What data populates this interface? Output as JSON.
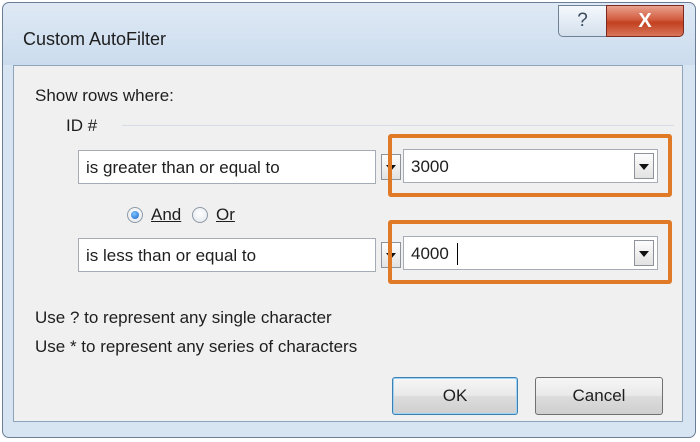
{
  "window": {
    "title": "Custom AutoFilter",
    "help_label": "?",
    "close_label": "X"
  },
  "filter": {
    "show_rows_label": "Show rows where:",
    "field_name": "ID #",
    "condition1": {
      "operator": "is greater than or equal to",
      "value": "3000"
    },
    "logic": {
      "and_label": "And",
      "or_label": "Or",
      "selected": "And"
    },
    "condition2": {
      "operator": "is less than or equal to",
      "value": "4000"
    }
  },
  "hints": {
    "line1": "Use ? to represent any single character",
    "line2": "Use * to represent any series of characters"
  },
  "buttons": {
    "ok": "OK",
    "cancel": "Cancel"
  },
  "colors": {
    "highlight": "#e07a26",
    "close_button": "#c2401f",
    "client_bg": "#f0f0f0"
  }
}
